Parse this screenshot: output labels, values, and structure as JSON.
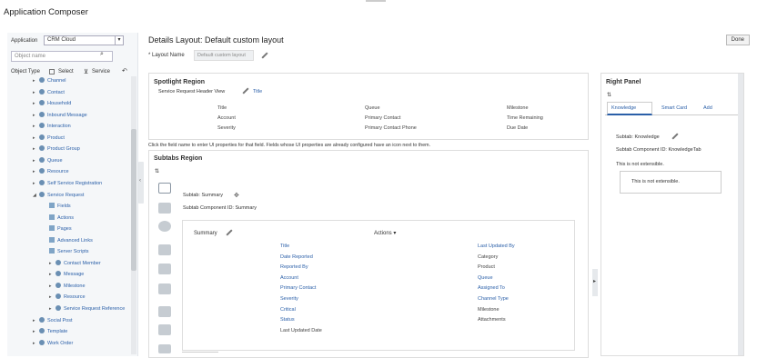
{
  "app_title": "Application Composer",
  "left": {
    "application_label": "Application",
    "application_value": "CRM Cloud",
    "search_placeholder": "Object name",
    "object_type_label": "Object Type",
    "select_label": "Select",
    "service_label": "Service",
    "tree": [
      {
        "label": "Channel",
        "level": 0,
        "expanded": false
      },
      {
        "label": "Contact",
        "level": 0,
        "expanded": false
      },
      {
        "label": "Household",
        "level": 0,
        "expanded": false
      },
      {
        "label": "Inbound Message",
        "level": 0,
        "expanded": false
      },
      {
        "label": "Interaction",
        "level": 0,
        "expanded": false
      },
      {
        "label": "Product",
        "level": 0,
        "expanded": false
      },
      {
        "label": "Product Group",
        "level": 0,
        "expanded": false
      },
      {
        "label": "Queue",
        "level": 0,
        "expanded": false
      },
      {
        "label": "Resource",
        "level": 0,
        "expanded": false
      },
      {
        "label": "Self Service Registration",
        "level": 0,
        "expanded": false
      },
      {
        "label": "Service Request",
        "level": 0,
        "expanded": true
      },
      {
        "label": "Fields",
        "level": 1,
        "expanded": null
      },
      {
        "label": "Actions",
        "level": 1,
        "expanded": null
      },
      {
        "label": "Pages",
        "level": 1,
        "expanded": null
      },
      {
        "label": "Advanced Links",
        "level": 1,
        "expanded": null
      },
      {
        "label": "Server Scripts",
        "level": 1,
        "expanded": null
      },
      {
        "label": "Contact Member",
        "level": 1,
        "expanded": false
      },
      {
        "label": "Message",
        "level": 1,
        "expanded": false
      },
      {
        "label": "Milestone",
        "level": 1,
        "expanded": false
      },
      {
        "label": "Resource",
        "level": 1,
        "expanded": false
      },
      {
        "label": "Service Request Reference",
        "level": 1,
        "expanded": false
      },
      {
        "label": "Social Post",
        "level": 0,
        "expanded": false
      },
      {
        "label": "Template",
        "level": 0,
        "expanded": false
      },
      {
        "label": "Work Order",
        "level": 0,
        "expanded": false
      }
    ]
  },
  "main": {
    "title": "Details Layout: Default custom layout",
    "done_label": "Done",
    "layout_name_label": "* Layout Name",
    "layout_name_value": "Default custom layout",
    "spotlight": {
      "title": "Spotlight Region",
      "header_view": "Service Request Header View",
      "header_field": "Title",
      "col1": [
        "Title",
        "Account",
        "Severity"
      ],
      "col2": [
        "Queue",
        "Primary Contact",
        "Primary Contact Phone"
      ],
      "col3": [
        "Milestone",
        "Time Remaining",
        "Due Date"
      ]
    },
    "hint": "Click the field name to enter UI properties for that field. Fields whose UI properties are already configured have an icon next to them.",
    "subtabs": {
      "title": "Subtabs Region",
      "subtab_label": "Subtab: Summary",
      "component_id": "Subtab Component ID: Summary",
      "summary_title": "Summary",
      "actions_label": "Actions",
      "col1": [
        "Title",
        "Date Reported",
        "Reported By",
        "Account",
        "Primary Contact",
        "Severity",
        "Critical",
        "Status",
        "Last Updated Date"
      ],
      "col2": [
        "Last Updated By",
        "Category",
        "Product",
        "Queue",
        "Assigned To",
        "Channel Type",
        "Milestone",
        "Attachments"
      ]
    }
  },
  "right_panel": {
    "title": "Right Panel",
    "tabs": [
      "Knowledge",
      "Smart Card",
      "Add"
    ],
    "subtab_knowledge": "Subtab: Knowledge",
    "component_id": "Subtab Component ID: KnowledgeTab",
    "not_extensible_1": "This is not extensible.",
    "not_extensible_2": "This is not extensible."
  },
  "colors": {
    "link": "#2a5fa8",
    "panel_bg": "#f5f7f9",
    "border": "#dddddd"
  }
}
